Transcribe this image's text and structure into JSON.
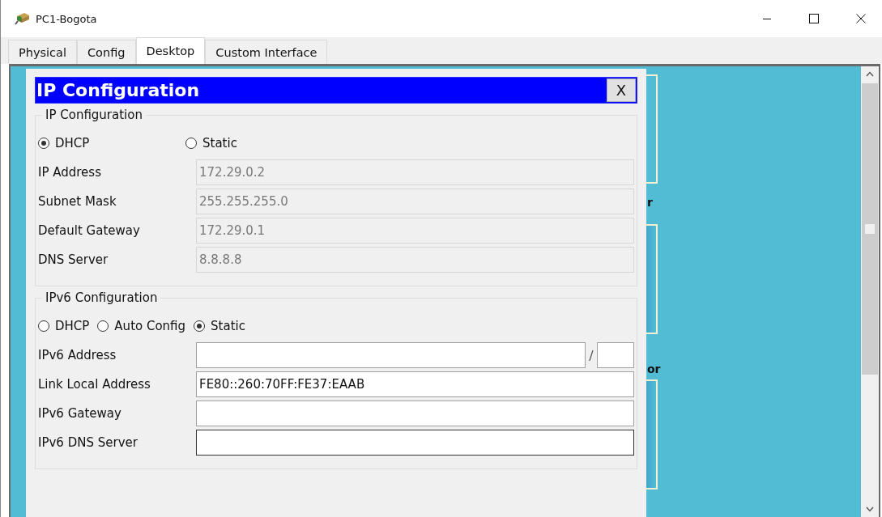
{
  "window": {
    "title": "PC1-Bogota"
  },
  "tabs": [
    {
      "label": "Physical",
      "selected": false
    },
    {
      "label": "Config",
      "selected": false
    },
    {
      "label": "Desktop",
      "selected": true
    },
    {
      "label": "Custom Interface",
      "selected": false
    }
  ],
  "desktop": {
    "label_fragments": [
      "r",
      "or"
    ]
  },
  "dialog": {
    "title": "IP Configuration",
    "close_label": "X",
    "ipv4": {
      "legend": "IP Configuration",
      "modes": [
        {
          "label": "DHCP",
          "selected": true
        },
        {
          "label": "Static",
          "selected": false
        }
      ],
      "fields": [
        {
          "label": "IP Address",
          "value": "172.29.0.2",
          "disabled": true
        },
        {
          "label": "Subnet Mask",
          "value": "255.255.255.0",
          "disabled": true
        },
        {
          "label": "Default Gateway",
          "value": "172.29.0.1",
          "disabled": true
        },
        {
          "label": "DNS Server",
          "value": "8.8.8.8",
          "disabled": true
        }
      ]
    },
    "ipv6": {
      "legend": "IPv6 Configuration",
      "modes": [
        {
          "label": "DHCP",
          "selected": false
        },
        {
          "label": "Auto Config",
          "selected": false
        },
        {
          "label": "Static",
          "selected": true
        }
      ],
      "fields": [
        {
          "label": "IPv6 Address",
          "kind": "prefixed",
          "separator": "/",
          "disabled": false,
          "focused": false
        },
        {
          "label": "Link Local Address",
          "kind": "plain",
          "value": "FE80::260:70FF:FE37:EAAB",
          "disabled": false,
          "focused": false
        },
        {
          "label": "IPv6 Gateway",
          "kind": "plain",
          "disabled": false,
          "focused": false
        },
        {
          "label": "IPv6 DNS Server",
          "kind": "plain",
          "disabled": false,
          "focused": true
        }
      ]
    }
  }
}
